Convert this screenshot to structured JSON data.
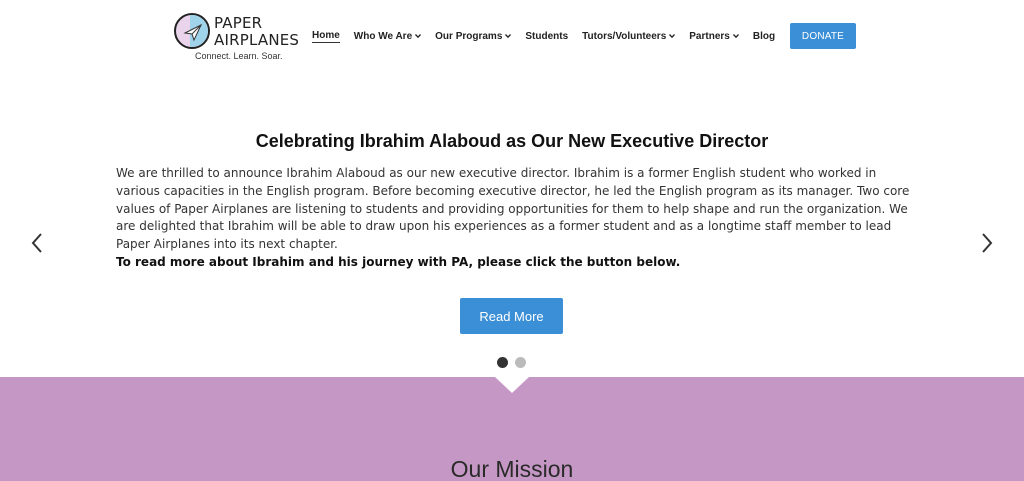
{
  "logo": {
    "line1": "PAPER",
    "line2": "AIRPLANES",
    "tagline": "Connect. Learn. Soar.",
    "icon": "paper-airplane-icon"
  },
  "nav": {
    "items": [
      {
        "label": "Home",
        "dropdown": false,
        "active": true
      },
      {
        "label": "Who We Are",
        "dropdown": true
      },
      {
        "label": "Our Programs",
        "dropdown": true
      },
      {
        "label": "Students",
        "dropdown": false
      },
      {
        "label": "Tutors/Volunteers",
        "dropdown": true
      },
      {
        "label": "Partners",
        "dropdown": true
      },
      {
        "label": "Blog",
        "dropdown": false
      }
    ],
    "donate_label": "DONATE"
  },
  "slide": {
    "title": "Celebrating Ibrahim Alaboud as Our New Executive Director",
    "body": "We are thrilled to announce Ibrahim Alaboud as our new executive director. Ibrahim is a former English student who worked in various capacities in the English program. Before becoming executive director, he led the English program as its manager. Two core values of Paper Airplanes are listening to students and providing opportunities for them to help shape and run the organization. We are delighted that Ibrahim will be able to draw upon his experiences as a former student and as a longtime staff member to lead Paper Airplanes into its next chapter.",
    "bold_line": "To read more about Ibrahim and his journey with PA, please click the button below.",
    "button_label": "Read More",
    "slide_count": 2,
    "active_slide": 1
  },
  "mission": {
    "title": "Our Mission"
  },
  "colors": {
    "accent": "#3b8fd6",
    "mission_bg": "#c597c4"
  }
}
